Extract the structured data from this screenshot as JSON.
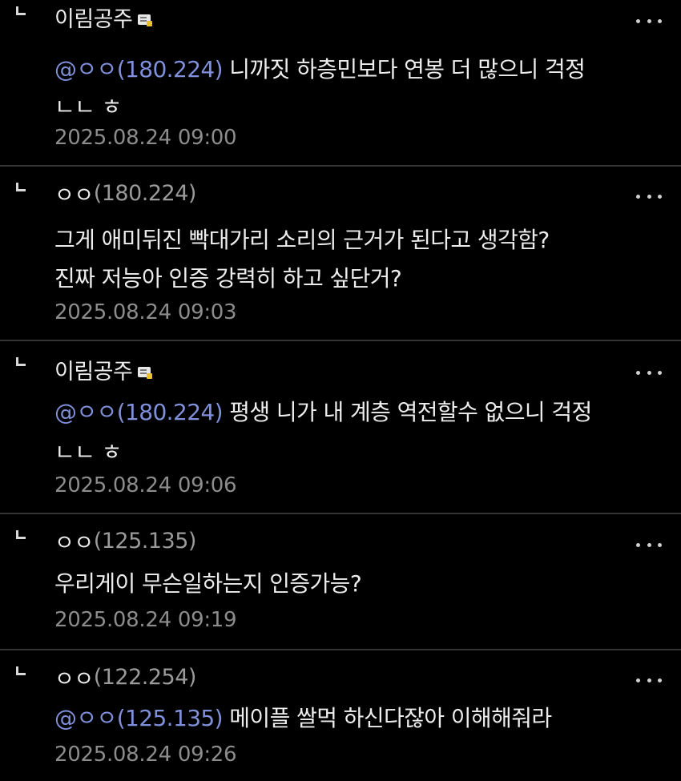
{
  "comments": [
    {
      "nickname": "이림공주",
      "ip": "",
      "has_badge": true,
      "mention": "@ㅇㅇ(180.224)",
      "text_line1": " 니까짓 하층민보다 연봉 더 많으니 걱정",
      "text_line2": "ㄴㄴ ㅎ",
      "timestamp": "2025.08.24 09:00"
    },
    {
      "nickname": "ㅇㅇ",
      "ip": "(180.224)",
      "has_badge": false,
      "mention": "",
      "text_line1": "그게 애미뒤진 빡대가리 소리의 근거가 된다고 생각함?",
      "text_line2": "진짜 저능아 인증 강력히 하고 싶단거?",
      "timestamp": "2025.08.24 09:03"
    },
    {
      "nickname": "이림공주",
      "ip": "",
      "has_badge": true,
      "mention": "@ㅇㅇ(180.224)",
      "text_line1": " 평생 니가 내 계층 역전할수 없으니 걱정",
      "text_line2": "ㄴㄴ ㅎ",
      "timestamp": "2025.08.24 09:06"
    },
    {
      "nickname": "ㅇㅇ",
      "ip": "(125.135)",
      "has_badge": false,
      "mention": "",
      "text_line1": "우리게이 무슨일하는지 인증가능?",
      "text_line2": "",
      "timestamp": "2025.08.24 09:19"
    },
    {
      "nickname": "ㅇㅇ",
      "ip": "(122.254)",
      "has_badge": false,
      "mention": "@ㅇㅇ(125.135)",
      "text_line1": " 메이플 쌀먹 하신다잖아 이해해줘라",
      "text_line2": "",
      "timestamp": "2025.08.24 09:26"
    }
  ],
  "icons": {
    "reply": "reply-arrow-icon",
    "more": "more-options-icon",
    "badge": "fixed-nickname-badge-icon"
  },
  "colors": {
    "background": "#000000",
    "text": "#ededed",
    "mention": "#7f8fd9",
    "meta": "#8c8c8c",
    "divider": "#333333"
  }
}
